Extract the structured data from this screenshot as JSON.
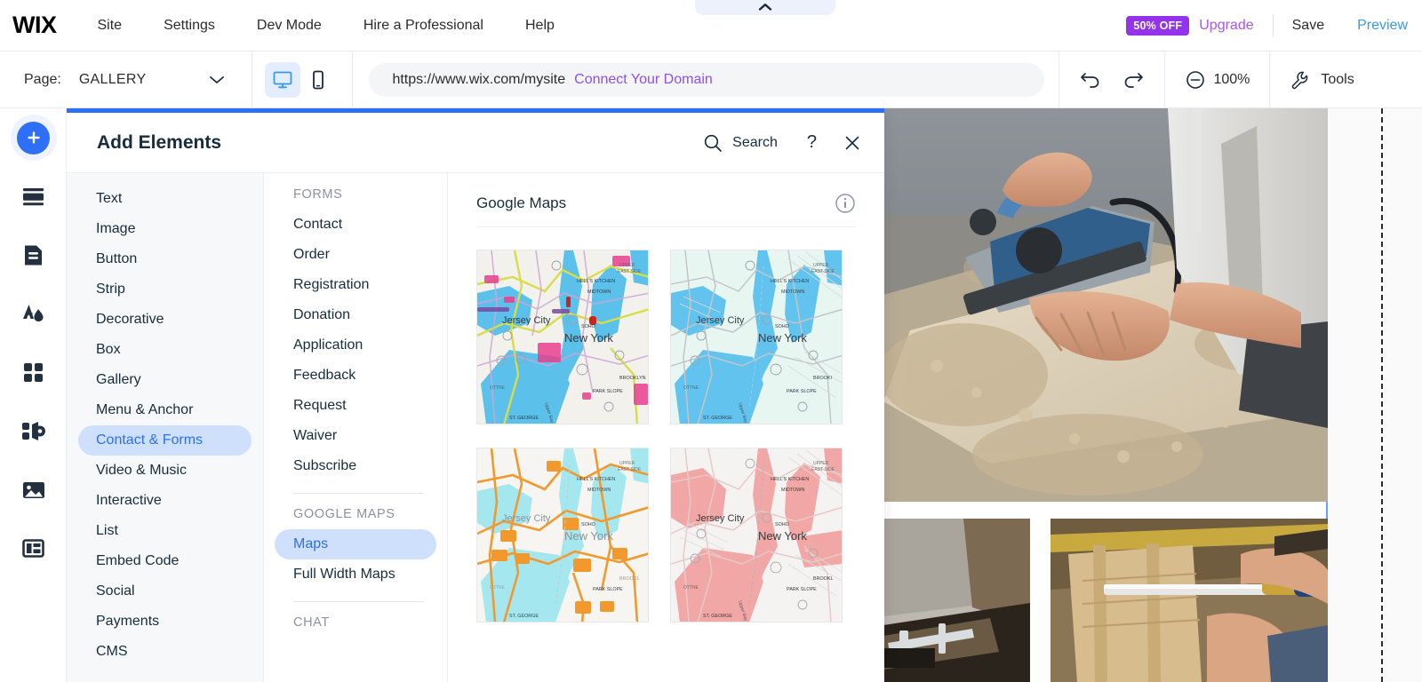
{
  "topbar": {
    "logo": "WIX",
    "menu": [
      "Site",
      "Settings",
      "Dev Mode",
      "Hire a Professional",
      "Help"
    ],
    "promo_badge": "50% OFF",
    "upgrade": "Upgrade",
    "save": "Save",
    "preview": "Preview",
    "accent_purple": "#9333ea",
    "accent_blue": "#3899ec"
  },
  "toolbar": {
    "page_label": "Page:",
    "page_name": "GALLERY",
    "url": "https://www.wix.com/mysite",
    "connect_domain": "Connect Your Domain",
    "zoom": "100%",
    "tools": "Tools",
    "desktop_icon": "desktop-icon",
    "mobile_icon": "mobile-icon",
    "undo_icon": "undo-icon",
    "redo_icon": "redo-icon",
    "zoom_out_icon": "zoom-out-icon",
    "tools_icon": "wrench-icon"
  },
  "rail": {
    "items": [
      {
        "icon": "add-icon",
        "name": "add-elements"
      },
      {
        "icon": "pages-icon",
        "name": "site-pages"
      },
      {
        "icon": "page-icon",
        "name": "page-design"
      },
      {
        "icon": "theme-icon",
        "name": "site-theme"
      },
      {
        "icon": "apps-icon",
        "name": "apps"
      },
      {
        "icon": "add-apps-icon",
        "name": "add-apps"
      },
      {
        "icon": "media-icon",
        "name": "media"
      },
      {
        "icon": "cms-icon",
        "name": "cms"
      }
    ]
  },
  "panel": {
    "title": "Add Elements",
    "search_label": "Search",
    "help_label": "?",
    "close_label": "×",
    "accent": "#2d6ff7",
    "categories": [
      {
        "label": "Text",
        "selected": false
      },
      {
        "label": "Image",
        "selected": false
      },
      {
        "label": "Button",
        "selected": false
      },
      {
        "label": "Strip",
        "selected": false
      },
      {
        "label": "Decorative",
        "selected": false
      },
      {
        "label": "Box",
        "selected": false
      },
      {
        "label": "Gallery",
        "selected": false
      },
      {
        "label": "Menu & Anchor",
        "selected": false
      },
      {
        "label": "Contact & Forms",
        "selected": true
      },
      {
        "label": "Video & Music",
        "selected": false
      },
      {
        "label": "Interactive",
        "selected": false
      },
      {
        "label": "List",
        "selected": false
      },
      {
        "label": "Embed Code",
        "selected": false
      },
      {
        "label": "Social",
        "selected": false
      },
      {
        "label": "Payments",
        "selected": false
      },
      {
        "label": "CMS",
        "selected": false
      }
    ],
    "subgroups": [
      {
        "heading": "FORMS",
        "items": [
          {
            "label": "Contact",
            "selected": false
          },
          {
            "label": "Order",
            "selected": false
          },
          {
            "label": "Registration",
            "selected": false
          },
          {
            "label": "Donation",
            "selected": false
          },
          {
            "label": "Application",
            "selected": false
          },
          {
            "label": "Feedback",
            "selected": false
          },
          {
            "label": "Request",
            "selected": false
          },
          {
            "label": "Waiver",
            "selected": false
          },
          {
            "label": "Subscribe",
            "selected": false
          }
        ]
      },
      {
        "heading": "GOOGLE MAPS",
        "items": [
          {
            "label": "Maps",
            "selected": true
          },
          {
            "label": "Full Width Maps",
            "selected": false
          }
        ]
      },
      {
        "heading": "CHAT",
        "items": []
      }
    ],
    "content": {
      "title": "Google Maps",
      "info_icon": "info-icon",
      "thumbnails": [
        {
          "name": "map-thumb-standard",
          "style": "standard",
          "labels": [
            "Jersey City",
            "New York",
            "HELL'S KITCHEN",
            "MIDTOWN",
            "UPPER EAST SIDE",
            "SOHO",
            "BROOKLYN",
            "PARK SLOPE",
            "ST. GEORGE",
            "Upper Bay"
          ],
          "water": "#5bc0ea",
          "land": "#f3f1ec",
          "road": "#d7dd49"
        },
        {
          "name": "map-thumb-light-blue",
          "style": "light-blue",
          "labels": [
            "Jersey City",
            "New York",
            "HELL'S KITCHEN",
            "MIDTOWN",
            "UPPER EAST SIDE",
            "SOHO",
            "BROOKLYN",
            "PARK SLOPE",
            "ST. GEORGE",
            "Upper Bay"
          ],
          "water": "#62c3ee",
          "land": "#e8f6f2",
          "road": "#c9c9c9"
        },
        {
          "name": "map-thumb-orange",
          "style": "orange",
          "labels": [
            "Jersey City",
            "New York",
            "HELL'S KITCHEN",
            "MIDTOWN",
            "UPPER EAST SIDE",
            "SOHO",
            "BROOKLYN",
            "PARK SLOPE",
            "ST. GEORGE",
            "Upper Bay"
          ],
          "water": "#a5e7ef",
          "land": "#f7f5f1",
          "road": "#f2992e"
        },
        {
          "name": "map-thumb-pink",
          "style": "pink",
          "labels": [
            "Jersey City",
            "New York",
            "HELL'S KITCHEN",
            "MIDTOWN",
            "UPPER EAST SIDE",
            "SOHO",
            "BROOKLYN",
            "PARK SLOPE",
            "ST. GEORGE",
            "Upper Bay"
          ],
          "water": "#f0a7a5",
          "land": "#f5f3f2",
          "road": "#e8c9c6"
        }
      ]
    }
  },
  "canvas": {
    "hero_photo": "woodworking-planer-photo",
    "lower_left_photo": "caliper-measuring-photo",
    "lower_right_photo": "hand-saw-photo"
  }
}
